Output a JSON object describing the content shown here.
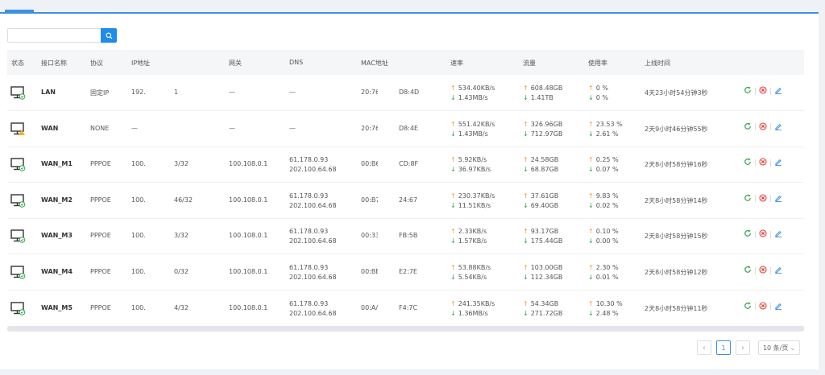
{
  "search": {
    "placeholder": "",
    "value": ""
  },
  "columns": {
    "status": "状态",
    "name": "接口名称",
    "proto": "协议",
    "ip": "IP地址",
    "gw": "网关",
    "dns": "DNS",
    "mac": "MAC地址",
    "rate": "速率",
    "traffic": "流量",
    "usage": "使用率",
    "uptime": "上线时间"
  },
  "rows": [
    {
      "status": "online",
      "name": "LAN",
      "proto": "固定IP",
      "ip_a": "192.",
      "ip_b": "1",
      "gw": "—",
      "dns1": "—",
      "dns2": "",
      "mac_a": "20:76",
      "mac_b": "D8:4D",
      "rate_up": "534.40KB/s",
      "rate_down": "1.43MB/s",
      "traffic_up": "608.48GB",
      "traffic_down": "1.41TB",
      "usage_up": "0 %",
      "usage_down": "0 %",
      "uptime": "4天23小时54分钟3秒"
    },
    {
      "status": "warning",
      "name": "WAN",
      "proto": "NONE",
      "ip_a": "—",
      "ip_b": "",
      "gw": "—",
      "dns1": "—",
      "dns2": "",
      "mac_a": "20:76",
      "mac_b": "D8:4E",
      "rate_up": "551.42KB/s",
      "rate_down": "1.43MB/s",
      "traffic_up": "326.96GB",
      "traffic_down": "712.97GB",
      "usage_up": "23.53 %",
      "usage_down": "2.61 %",
      "uptime": "2天9小时46分钟55秒"
    },
    {
      "status": "online",
      "name": "WAN_M1",
      "proto": "PPPOE",
      "ip_a": "100.",
      "ip_b": "3/32",
      "gw": "100.108.0.1",
      "dns1": "61.178.0.93",
      "dns2": "202.100.64.68",
      "mac_a": "00:B6",
      "mac_b": "CD:8F",
      "rate_up": "5.92KB/s",
      "rate_down": "36.97KB/s",
      "traffic_up": "24.58GB",
      "traffic_down": "68.87GB",
      "usage_up": "0.25 %",
      "usage_down": "0.07 %",
      "uptime": "2天8小时58分钟16秒"
    },
    {
      "status": "online",
      "name": "WAN_M2",
      "proto": "PPPOE",
      "ip_a": "100.",
      "ip_b": "46/32",
      "gw": "100.108.0.1",
      "dns1": "61.178.0.93",
      "dns2": "202.100.64.68",
      "mac_a": "00:B7",
      "mac_b": "24:67",
      "rate_up": "230.37KB/s",
      "rate_down": "11.51KB/s",
      "traffic_up": "37.61GB",
      "traffic_down": "69.40GB",
      "usage_up": "9.83 %",
      "usage_down": "0.02 %",
      "uptime": "2天8小时58分钟14秒"
    },
    {
      "status": "online",
      "name": "WAN_M3",
      "proto": "PPPOE",
      "ip_a": "100.",
      "ip_b": "3/32",
      "gw": "100.108.0.1",
      "dns1": "61.178.0.93",
      "dns2": "202.100.64.68",
      "mac_a": "00:33",
      "mac_b": "FB:5B",
      "rate_up": "2.33KB/s",
      "rate_down": "1.57KB/s",
      "traffic_up": "93.17GB",
      "traffic_down": "175.44GB",
      "usage_up": "0.10 %",
      "usage_down": "0.00 %",
      "uptime": "2天8小时58分钟15秒"
    },
    {
      "status": "online",
      "name": "WAN_M4",
      "proto": "PPPOE",
      "ip_a": "100.",
      "ip_b": "0/32",
      "gw": "100.108.0.1",
      "dns1": "61.178.0.93",
      "dns2": "202.100.64.68",
      "mac_a": "00:BE",
      "mac_b": "E2:7E",
      "rate_up": "53.88KB/s",
      "rate_down": "5.54KB/s",
      "traffic_up": "103.00GB",
      "traffic_down": "112.34GB",
      "usage_up": "2.30 %",
      "usage_down": "0.01 %",
      "uptime": "2天8小时58分钟12秒"
    },
    {
      "status": "online",
      "name": "WAN_M5",
      "proto": "PPPOE",
      "ip_a": "100.",
      "ip_b": "4/32",
      "gw": "100.108.0.1",
      "dns1": "61.178.0.93",
      "dns2": "202.100.64.68",
      "mac_a": "00:A/",
      "mac_b": "F4:7C",
      "rate_up": "241.35KB/s",
      "rate_down": "1.36MB/s",
      "traffic_up": "54.34GB",
      "traffic_down": "271.72GB",
      "usage_up": "10.30 %",
      "usage_down": "2.48 %",
      "uptime": "2天8小时58分钟11秒"
    }
  ],
  "pagination": {
    "prev": "‹",
    "current": "1",
    "next": "›",
    "page_size": "10 条/页"
  },
  "colors": {
    "accent": "#1e8ce8",
    "up": "#f0a030",
    "down": "#2fa34a",
    "refresh": "#2fa34a",
    "delete": "#e53935",
    "edit": "#3d8fe0"
  },
  "icons": {
    "status": "monitor-icon",
    "search": "search-icon",
    "refresh": "refresh-icon",
    "delete": "close-circle-icon",
    "edit": "edit-icon"
  }
}
